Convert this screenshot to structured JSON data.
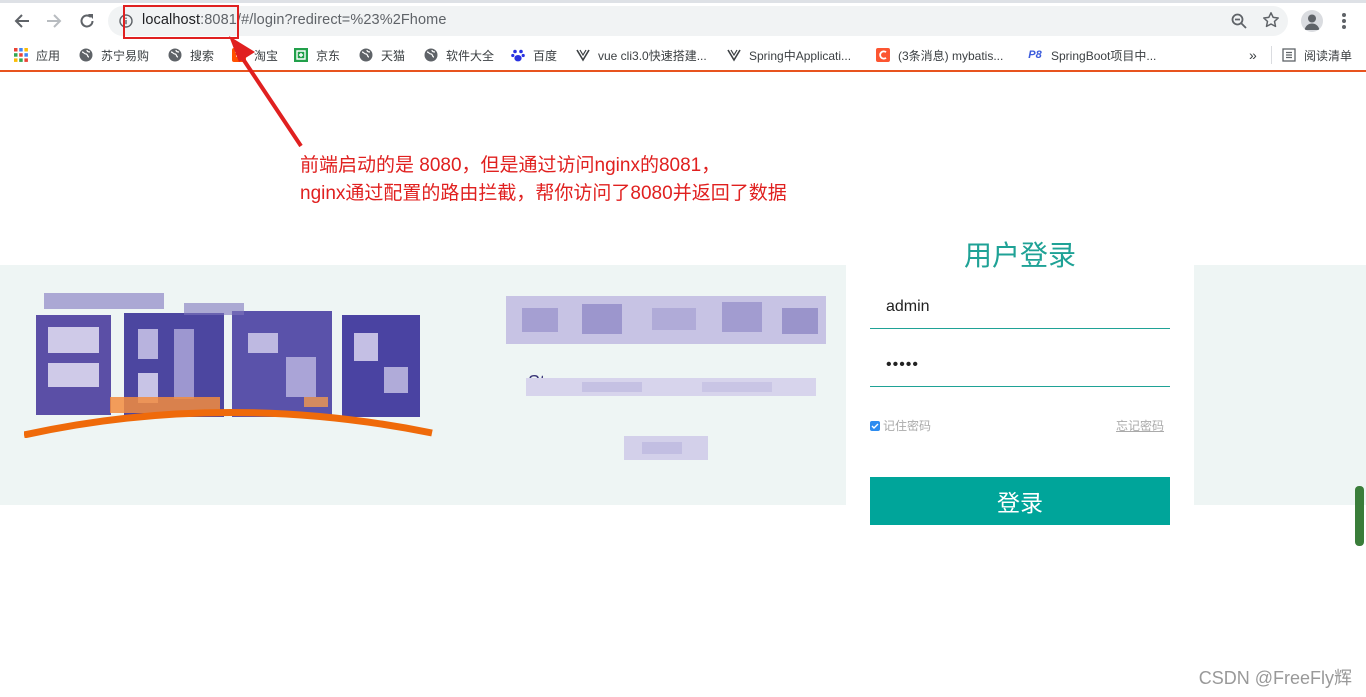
{
  "browser": {
    "url_host": "localhost",
    "url_port": ":8081",
    "url_path": "/#/login?redirect=%23%2Fhome"
  },
  "bookmarks": [
    {
      "label": "应用",
      "icon": "apps-grid-icon"
    },
    {
      "label": "苏宁易购",
      "icon": "globe-icon"
    },
    {
      "label": "搜索",
      "icon": "globe-icon"
    },
    {
      "label": "淘宝",
      "icon": "taobao-icon"
    },
    {
      "label": "京东",
      "icon": "jd-icon"
    },
    {
      "label": "天猫",
      "icon": "globe-icon"
    },
    {
      "label": "软件大全",
      "icon": "globe-icon"
    },
    {
      "label": "百度",
      "icon": "baidu-paw-icon"
    },
    {
      "label": "vue cli3.0快速搭建...",
      "icon": "vue-icon"
    },
    {
      "label": "Spring中Applicati...",
      "icon": "spring-icon"
    },
    {
      "label": "(3条消息) mybatis...",
      "icon": "csdn-icon"
    },
    {
      "label": "SpringBoot项目中...",
      "icon": "p8-icon"
    }
  ],
  "bookmarks_overflow": "»",
  "reading_list": "阅读清单",
  "annotation": {
    "line1": "前端启动的是 8080，但是通过访问nginx的8081，",
    "line2": "nginx通过配置的路由拦截，帮你访问了8080并返回了数据"
  },
  "login": {
    "title": "用户登录",
    "username": "admin",
    "password": "•••••",
    "remember": "记住密码",
    "forgot": "忘记密码",
    "submit": "登录"
  },
  "watermark": "CSDN @FreeFly辉",
  "colors": {
    "accent": "#00a59a",
    "title": "#1fa296",
    "annotation": "#e0201f",
    "banner_bg": "#eef5f4"
  }
}
